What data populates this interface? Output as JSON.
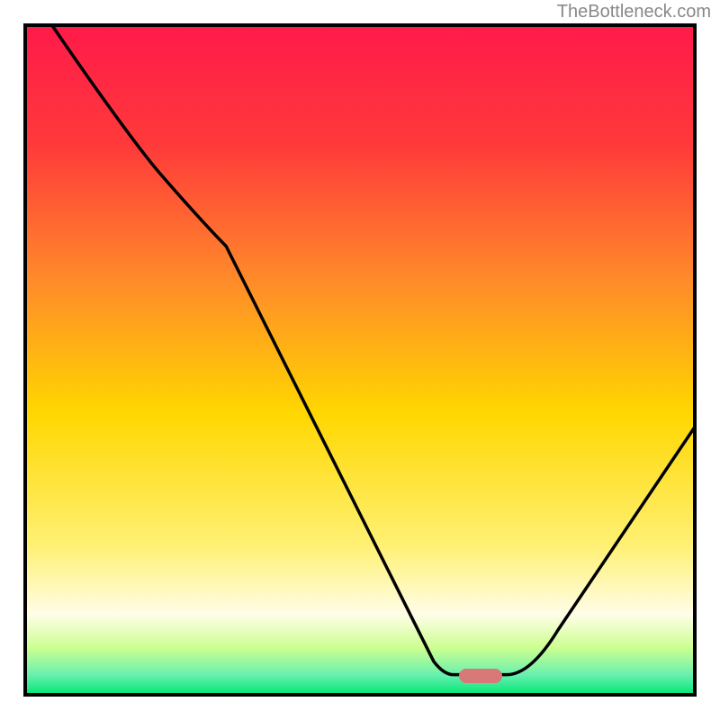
{
  "watermark": "TheBottleneck.com",
  "chart_data": {
    "type": "line",
    "title": "",
    "xlabel": "",
    "ylabel": "",
    "xlim": [
      0,
      100
    ],
    "ylim": [
      0,
      100
    ],
    "background_gradient": {
      "top": "#ff1a4a",
      "upper_mid": "#ff7a2a",
      "mid": "#ffd700",
      "lower_mid": "#fff59d",
      "near_bottom": "#ccff66",
      "bottom": "#00e676"
    },
    "plot_border": "#000000",
    "marker": {
      "x": 68,
      "y": 3,
      "color": "#d87878"
    },
    "curve": {
      "description": "Bottleneck curve descending from top-left to a minimum near x=68 then rising to right edge",
      "points": [
        {
          "x": 4,
          "y": 100
        },
        {
          "x": 20,
          "y": 78
        },
        {
          "x": 30,
          "y": 67
        },
        {
          "x": 61,
          "y": 5
        },
        {
          "x": 64,
          "y": 3
        },
        {
          "x": 72,
          "y": 3
        },
        {
          "x": 100,
          "y": 40
        }
      ]
    }
  }
}
